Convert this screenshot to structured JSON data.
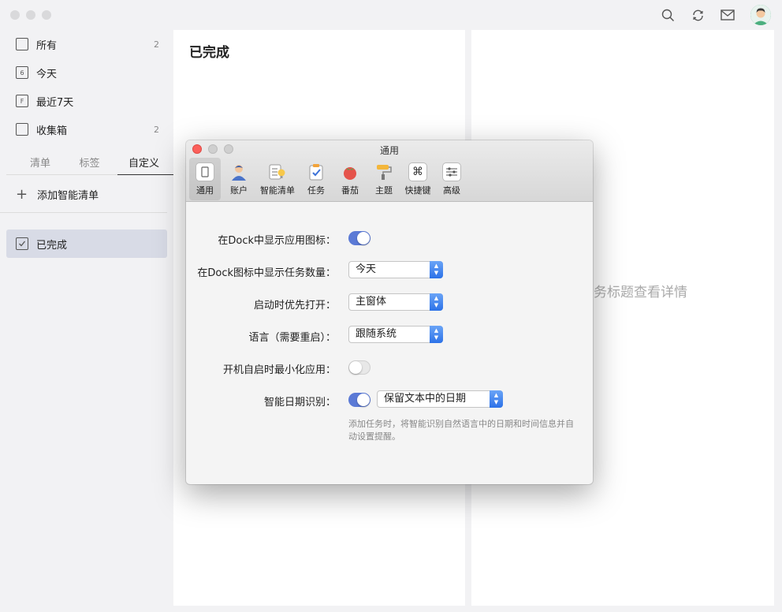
{
  "sidebar": {
    "items": [
      {
        "label": "所有",
        "count": "2",
        "icon": "inbox-all-icon",
        "glyph": ""
      },
      {
        "label": "今天",
        "count": "",
        "icon": "calendar-today-icon",
        "glyph": "6"
      },
      {
        "label": "最近7天",
        "count": "",
        "icon": "calendar-week-icon",
        "glyph": "F"
      },
      {
        "label": "收集箱",
        "count": "2",
        "icon": "inbox-icon",
        "glyph": ""
      }
    ],
    "tabs": [
      "清单",
      "标签",
      "自定义"
    ],
    "add_smart_list": "添加智能清单",
    "completed": "已完成"
  },
  "list_panel": {
    "title": "已完成"
  },
  "detail_panel": {
    "hint": "务标题查看详情"
  },
  "dialog": {
    "title": "通用",
    "toolbar": [
      "通用",
      "账户",
      "智能清单",
      "任务",
      "番茄",
      "主题",
      "快捷键",
      "高级"
    ],
    "settings": {
      "dock_icon_label": "在Dock中显示应用图标：",
      "dock_count_label": "在Dock图标中显示任务数量：",
      "dock_count_value": "今天",
      "startup_label": "启动时优先打开：",
      "startup_value": "主窗体",
      "language_label": "语言（需要重启）：",
      "language_value": "跟随系统",
      "minimize_label": "开机自启时最小化应用：",
      "smart_date_label": "智能日期识别：",
      "smart_date_value": "保留文本中的日期",
      "hint": "添加任务时，将智能识别自然语言中的日期和时间信息并自动设置提醒。"
    },
    "toggles": {
      "dock_icon": true,
      "minimize": false,
      "smart_date": true
    }
  },
  "colors": {
    "accent": "#5b7ad6",
    "select_arrow": "#2c72e8",
    "close": "#fc605b"
  }
}
